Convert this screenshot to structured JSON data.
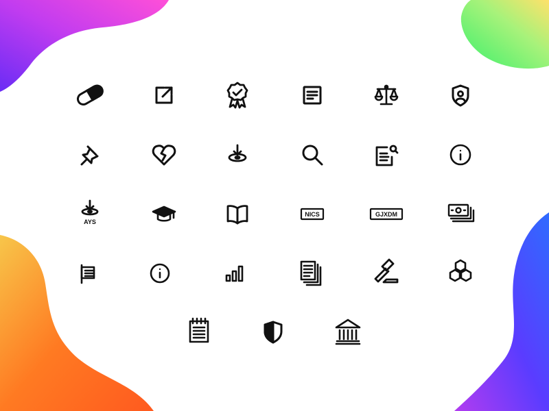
{
  "colors": {
    "background": "#ffffff",
    "icon_stroke": "#111111",
    "blob_top_left": [
      "#6a2cf5",
      "#c13cf0",
      "#ff4fd8"
    ],
    "blob_top_right": [
      "#3af06c",
      "#a7f27a",
      "#ffe16a"
    ],
    "blob_bottom_left": [
      "#f7c64a",
      "#ff7a22",
      "#ff5a1f"
    ],
    "blob_bottom_right": [
      "#2f6bff",
      "#5a3cff",
      "#b23cf0"
    ]
  },
  "icons": [
    {
      "name": "pill-icon"
    },
    {
      "name": "external-link-icon"
    },
    {
      "name": "award-ribbon-icon"
    },
    {
      "name": "document-icon"
    },
    {
      "name": "scales-of-justice-icon"
    },
    {
      "name": "shield-user-icon"
    },
    {
      "name": "pushpin-icon"
    },
    {
      "name": "broken-heart-icon"
    },
    {
      "name": "location-drop-icon"
    },
    {
      "name": "magnifier-icon"
    },
    {
      "name": "document-search-icon"
    },
    {
      "name": "info-circle-icon"
    },
    {
      "name": "ays-location-drop-icon",
      "label": "AYS"
    },
    {
      "name": "graduation-cap-icon"
    },
    {
      "name": "open-book-icon"
    },
    {
      "name": "nics-badge-icon",
      "label": "NICS"
    },
    {
      "name": "gjxdm-badge-icon",
      "label": "GJXDM"
    },
    {
      "name": "money-stack-icon"
    },
    {
      "name": "flag-icon"
    },
    {
      "name": "info-circle-small-icon"
    },
    {
      "name": "signal-bars-icon"
    },
    {
      "name": "document-stack-icon"
    },
    {
      "name": "gavel-icon"
    },
    {
      "name": "hexagon-cluster-icon"
    },
    {
      "name": "notepad-icon"
    },
    {
      "name": "shield-half-icon"
    },
    {
      "name": "courthouse-icon"
    }
  ]
}
